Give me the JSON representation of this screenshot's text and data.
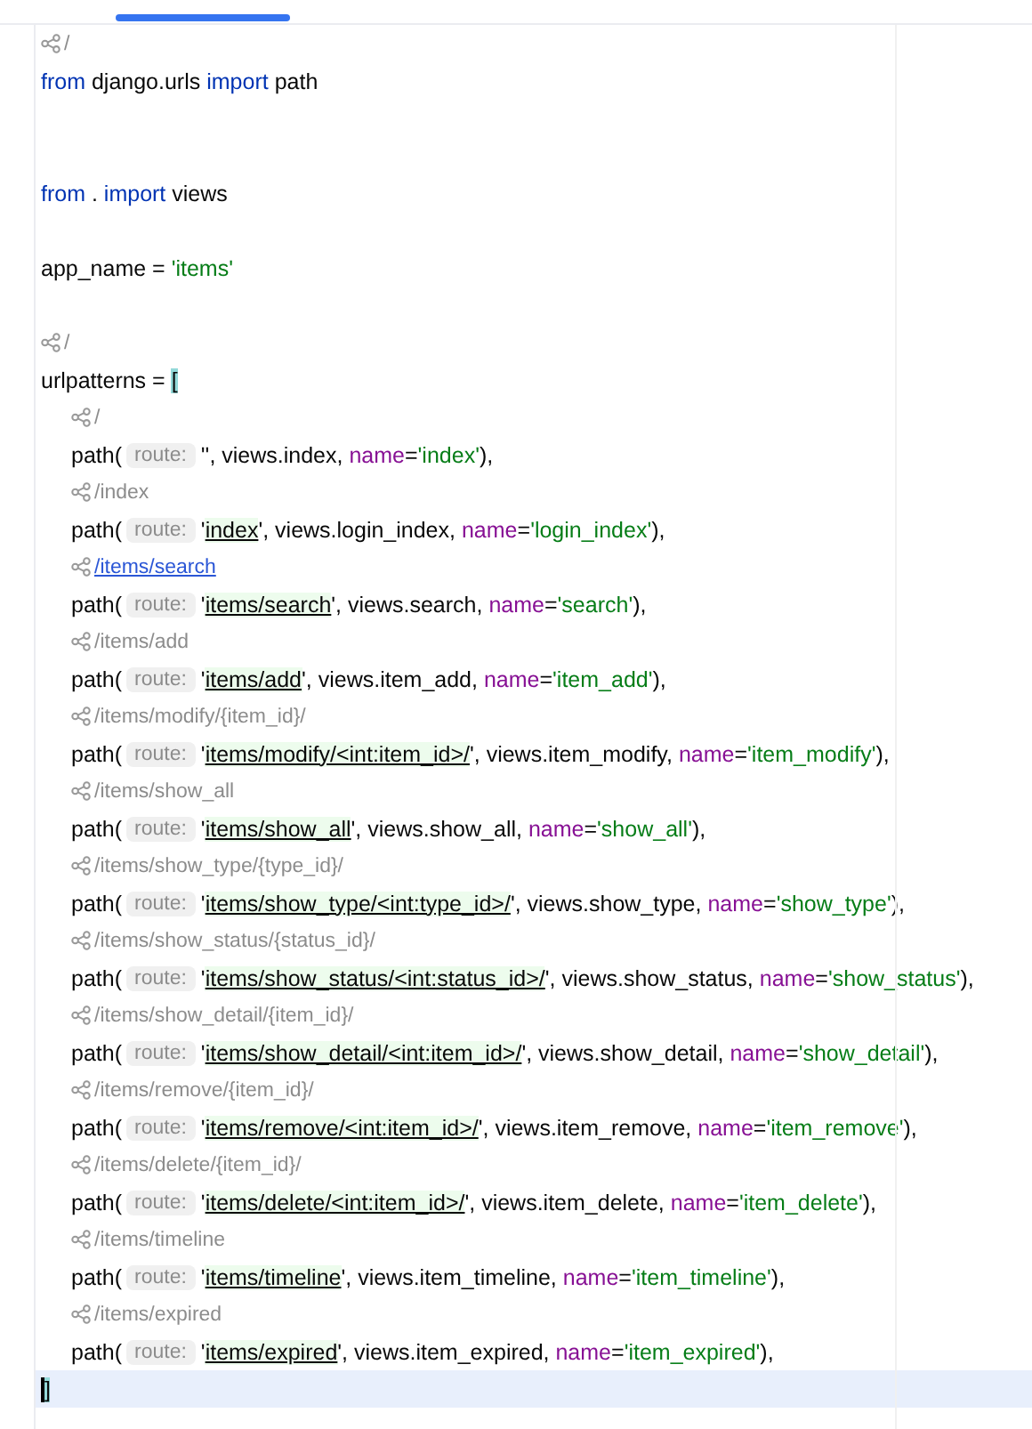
{
  "lines": [
    {
      "kind": "hint",
      "text": "/",
      "link": false
    },
    {
      "kind": "code",
      "tokens": [
        {
          "kind": "kw",
          "t": "from"
        },
        {
          "kind": "plain",
          "t": " django.urls "
        },
        {
          "kind": "kw",
          "t": "import"
        },
        {
          "kind": "plain",
          "t": " path"
        }
      ]
    },
    {
      "kind": "blank"
    },
    {
      "kind": "blank"
    },
    {
      "kind": "code",
      "tokens": [
        {
          "kind": "kw",
          "t": "from"
        },
        {
          "kind": "plain",
          "t": " . "
        },
        {
          "kind": "kw",
          "t": "import"
        },
        {
          "kind": "plain",
          "t": " views"
        }
      ]
    },
    {
      "kind": "blank"
    },
    {
      "kind": "code",
      "tokens": [
        {
          "kind": "plain",
          "t": "app_name = "
        },
        {
          "kind": "str",
          "t": "'items'"
        }
      ]
    },
    {
      "kind": "blank"
    },
    {
      "kind": "hint",
      "text": "/",
      "link": false
    }
  ],
  "block": {
    "tokens": [
      {
        "kind": "plain",
        "t": "urlpatterns = "
      },
      {
        "kind": "bracket",
        "t": "["
      }
    ],
    "entries": [
      {
        "hint": "/",
        "link": false,
        "tokens": [
          {
            "kind": "plain",
            "t": "path("
          },
          {
            "kind": "inlay",
            "t": "route:"
          },
          {
            "kind": "plain",
            "t": "'', views.index, "
          },
          {
            "kind": "param",
            "t": "name"
          },
          {
            "kind": "plain",
            "t": "="
          },
          {
            "kind": "str",
            "t": "'index'"
          },
          {
            "kind": "plain",
            "t": "),"
          }
        ]
      },
      {
        "hint": "/index",
        "link": false,
        "tokens": [
          {
            "kind": "plain",
            "t": "path("
          },
          {
            "kind": "inlay",
            "t": "route:"
          },
          {
            "kind": "plain",
            "t": "'"
          },
          {
            "kind": "route",
            "t": "index"
          },
          {
            "kind": "plain",
            "t": "', views.login_index, "
          },
          {
            "kind": "param",
            "t": "name"
          },
          {
            "kind": "plain",
            "t": "="
          },
          {
            "kind": "str",
            "t": "'login_index'"
          },
          {
            "kind": "plain",
            "t": "),"
          }
        ]
      },
      {
        "hint": "/items/search",
        "link": true,
        "tokens": [
          {
            "kind": "plain",
            "t": "path("
          },
          {
            "kind": "inlay",
            "t": "route:"
          },
          {
            "kind": "plain",
            "t": "'"
          },
          {
            "kind": "route",
            "t": "items/search"
          },
          {
            "kind": "plain",
            "t": "', views.search, "
          },
          {
            "kind": "param",
            "t": "name"
          },
          {
            "kind": "plain",
            "t": "="
          },
          {
            "kind": "str",
            "t": "'search'"
          },
          {
            "kind": "plain",
            "t": "),"
          }
        ]
      },
      {
        "hint": "/items/add",
        "link": false,
        "tokens": [
          {
            "kind": "plain",
            "t": "path("
          },
          {
            "kind": "inlay",
            "t": "route:"
          },
          {
            "kind": "plain",
            "t": "'"
          },
          {
            "kind": "route",
            "t": "items/add"
          },
          {
            "kind": "plain",
            "t": "', views.item_add, "
          },
          {
            "kind": "param",
            "t": "name"
          },
          {
            "kind": "plain",
            "t": "="
          },
          {
            "kind": "str",
            "t": "'item_add'"
          },
          {
            "kind": "plain",
            "t": "),"
          }
        ]
      },
      {
        "hint": "/items/modify/{item_id}/",
        "link": false,
        "tokens": [
          {
            "kind": "plain",
            "t": "path("
          },
          {
            "kind": "inlay",
            "t": "route:"
          },
          {
            "kind": "plain",
            "t": "'"
          },
          {
            "kind": "route",
            "t": "items/modify/<int:item_id>/"
          },
          {
            "kind": "plain",
            "t": "', views.item_modify, "
          },
          {
            "kind": "param",
            "t": "name"
          },
          {
            "kind": "plain",
            "t": "="
          },
          {
            "kind": "str",
            "t": "'item_modify'"
          },
          {
            "kind": "plain",
            "t": "),"
          }
        ]
      },
      {
        "hint": "/items/show_all",
        "link": false,
        "tokens": [
          {
            "kind": "plain",
            "t": "path("
          },
          {
            "kind": "inlay",
            "t": "route:"
          },
          {
            "kind": "plain",
            "t": "'"
          },
          {
            "kind": "route",
            "t": "items/show_all"
          },
          {
            "kind": "plain",
            "t": "', views.show_all, "
          },
          {
            "kind": "param",
            "t": "name"
          },
          {
            "kind": "plain",
            "t": "="
          },
          {
            "kind": "str",
            "t": "'show_all'"
          },
          {
            "kind": "plain",
            "t": "),"
          }
        ]
      },
      {
        "hint": "/items/show_type/{type_id}/",
        "link": false,
        "tokens": [
          {
            "kind": "plain",
            "t": "path("
          },
          {
            "kind": "inlay",
            "t": "route:"
          },
          {
            "kind": "plain",
            "t": "'"
          },
          {
            "kind": "route",
            "t": "items/show_type/<int:type_id>/"
          },
          {
            "kind": "plain",
            "t": "', views.show_type, "
          },
          {
            "kind": "param",
            "t": "name"
          },
          {
            "kind": "plain",
            "t": "="
          },
          {
            "kind": "str",
            "t": "'show_type'"
          },
          {
            "kind": "plain",
            "t": "),"
          }
        ]
      },
      {
        "hint": "/items/show_status/{status_id}/",
        "link": false,
        "tokens": [
          {
            "kind": "plain",
            "t": "path("
          },
          {
            "kind": "inlay",
            "t": "route:"
          },
          {
            "kind": "plain",
            "t": "'"
          },
          {
            "kind": "route",
            "t": "items/show_status/<int:status_id>/"
          },
          {
            "kind": "plain",
            "t": "', views.show_status, "
          },
          {
            "kind": "param",
            "t": "name"
          },
          {
            "kind": "plain",
            "t": "="
          },
          {
            "kind": "str",
            "t": "'show_status'"
          },
          {
            "kind": "plain",
            "t": "),"
          }
        ]
      },
      {
        "hint": "/items/show_detail/{item_id}/",
        "link": false,
        "tokens": [
          {
            "kind": "plain",
            "t": "path("
          },
          {
            "kind": "inlay",
            "t": "route:"
          },
          {
            "kind": "plain",
            "t": "'"
          },
          {
            "kind": "route",
            "t": "items/show_detail/<int:item_id>/"
          },
          {
            "kind": "plain",
            "t": "', views.show_detail, "
          },
          {
            "kind": "param",
            "t": "name"
          },
          {
            "kind": "plain",
            "t": "="
          },
          {
            "kind": "str",
            "t": "'show_detail'"
          },
          {
            "kind": "plain",
            "t": "),"
          }
        ]
      },
      {
        "hint": "/items/remove/{item_id}/",
        "link": false,
        "tokens": [
          {
            "kind": "plain",
            "t": "path("
          },
          {
            "kind": "inlay",
            "t": "route:"
          },
          {
            "kind": "plain",
            "t": "'"
          },
          {
            "kind": "route",
            "t": "items/remove/<int:item_id>/"
          },
          {
            "kind": "plain",
            "t": "', views.item_remove, "
          },
          {
            "kind": "param",
            "t": "name"
          },
          {
            "kind": "plain",
            "t": "="
          },
          {
            "kind": "str",
            "t": "'item_remove'"
          },
          {
            "kind": "plain",
            "t": "),"
          }
        ]
      },
      {
        "hint": "/items/delete/{item_id}/",
        "link": false,
        "tokens": [
          {
            "kind": "plain",
            "t": "path("
          },
          {
            "kind": "inlay",
            "t": "route:"
          },
          {
            "kind": "plain",
            "t": "'"
          },
          {
            "kind": "route",
            "t": "items/delete/<int:item_id>/"
          },
          {
            "kind": "plain",
            "t": "', views.item_delete, "
          },
          {
            "kind": "param",
            "t": "name"
          },
          {
            "kind": "plain",
            "t": "="
          },
          {
            "kind": "str",
            "t": "'item_delete'"
          },
          {
            "kind": "plain",
            "t": "),"
          }
        ]
      },
      {
        "hint": "/items/timeline",
        "link": false,
        "tokens": [
          {
            "kind": "plain",
            "t": "path("
          },
          {
            "kind": "inlay",
            "t": "route:"
          },
          {
            "kind": "plain",
            "t": "'"
          },
          {
            "kind": "route",
            "t": "items/timeline"
          },
          {
            "kind": "plain",
            "t": "', views.item_timeline, "
          },
          {
            "kind": "param",
            "t": "name"
          },
          {
            "kind": "plain",
            "t": "="
          },
          {
            "kind": "str",
            "t": "'item_timeline'"
          },
          {
            "kind": "plain",
            "t": "),"
          }
        ]
      },
      {
        "hint": "/items/expired",
        "link": false,
        "tokens": [
          {
            "kind": "plain",
            "t": "path("
          },
          {
            "kind": "inlay",
            "t": "route:"
          },
          {
            "kind": "plain",
            "t": "'"
          },
          {
            "kind": "route",
            "t": "items/expired"
          },
          {
            "kind": "plain",
            "t": "', views.item_expired, "
          },
          {
            "kind": "param",
            "t": "name"
          },
          {
            "kind": "plain",
            "t": "="
          },
          {
            "kind": "str",
            "t": "'item_expired'"
          },
          {
            "kind": "plain",
            "t": "),"
          }
        ]
      }
    ],
    "closing": {
      "text": "]",
      "current": true
    }
  }
}
